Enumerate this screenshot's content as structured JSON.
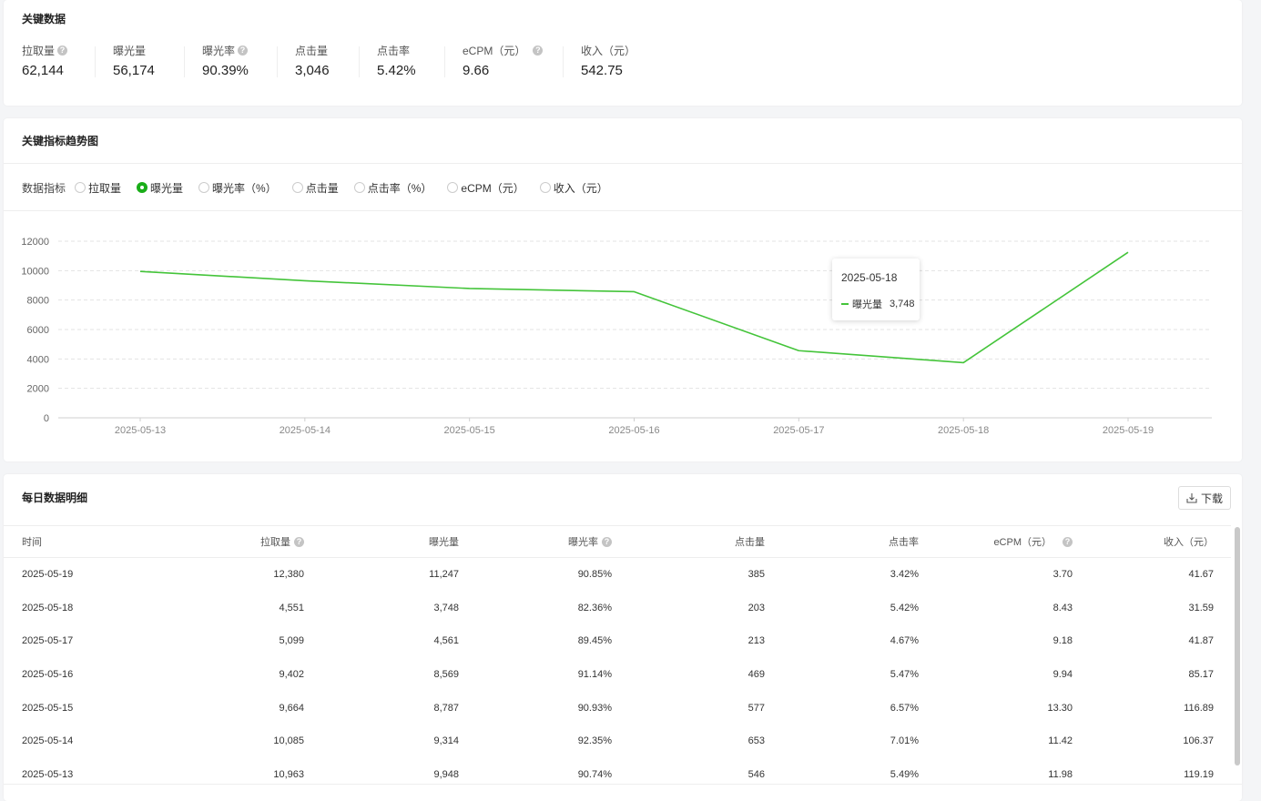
{
  "kpi": {
    "title": "关键数据",
    "items": [
      {
        "label": "拉取量",
        "value": "62,144",
        "help": true
      },
      {
        "label": "曝光量",
        "value": "56,174",
        "help": false
      },
      {
        "label": "曝光率",
        "value": "90.39%",
        "help": true
      },
      {
        "label": "点击量",
        "value": "3,046",
        "help": false
      },
      {
        "label": "点击率",
        "value": "5.42%",
        "help": false
      },
      {
        "label": "eCPM（元）",
        "value": "9.66",
        "help": true
      },
      {
        "label": "收入（元）",
        "value": "542.75",
        "help": false
      }
    ]
  },
  "trend": {
    "title": "关键指标趋势图",
    "metric_label": "数据指标",
    "options": [
      {
        "label": "拉取量",
        "checked": false
      },
      {
        "label": "曝光量",
        "checked": true
      },
      {
        "label": "曝光率（%）",
        "checked": false
      },
      {
        "label": "点击量",
        "checked": false
      },
      {
        "label": "点击率（%）",
        "checked": false
      },
      {
        "label": "eCPM（元）",
        "checked": false
      },
      {
        "label": "收入（元）",
        "checked": false
      }
    ],
    "tooltip": {
      "date": "2025-05-18",
      "series": "曝光量",
      "value": "3,748"
    }
  },
  "chart_data": {
    "type": "line",
    "x": [
      "2025-05-13",
      "2025-05-14",
      "2025-05-15",
      "2025-05-16",
      "2025-05-17",
      "2025-05-18",
      "2025-05-19"
    ],
    "series": [
      {
        "name": "曝光量",
        "values": [
          9948,
          9314,
          8787,
          8569,
          4561,
          3748,
          11247
        ],
        "color": "#44c43a"
      }
    ],
    "y_ticks": [
      0,
      2000,
      4000,
      6000,
      8000,
      10000,
      12000
    ],
    "ylim": [
      0,
      12000
    ],
    "grid": true
  },
  "table": {
    "title": "每日数据明细",
    "download_label": "下载",
    "columns": [
      "时间",
      "拉取量",
      "曝光量",
      "曝光率",
      "点击量",
      "点击率",
      "eCPM（元）",
      "收入（元）"
    ],
    "column_help": [
      false,
      true,
      false,
      true,
      false,
      false,
      true,
      false
    ],
    "rows": [
      [
        "2025-05-19",
        "12,380",
        "11,247",
        "90.85%",
        "385",
        "3.42%",
        "3.70",
        "41.67"
      ],
      [
        "2025-05-18",
        "4,551",
        "3,748",
        "82.36%",
        "203",
        "5.42%",
        "8.43",
        "31.59"
      ],
      [
        "2025-05-17",
        "5,099",
        "4,561",
        "89.45%",
        "213",
        "4.67%",
        "9.18",
        "41.87"
      ],
      [
        "2025-05-16",
        "9,402",
        "8,569",
        "91.14%",
        "469",
        "5.47%",
        "9.94",
        "85.17"
      ],
      [
        "2025-05-15",
        "9,664",
        "8,787",
        "90.93%",
        "577",
        "6.57%",
        "13.30",
        "116.89"
      ],
      [
        "2025-05-14",
        "10,085",
        "9,314",
        "92.35%",
        "653",
        "7.01%",
        "11.42",
        "106.37"
      ],
      [
        "2025-05-13",
        "10,963",
        "9,948",
        "90.74%",
        "546",
        "5.49%",
        "11.98",
        "119.19"
      ]
    ]
  }
}
